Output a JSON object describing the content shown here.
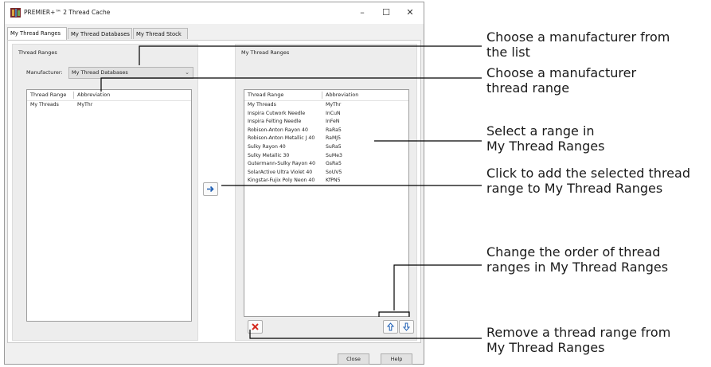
{
  "window": {
    "title": "PREMIER+™ 2 Thread Cache",
    "minimize": "–",
    "maximize": "☐",
    "close": "✕"
  },
  "tabs": [
    {
      "label": "My Thread Ranges",
      "active": true
    },
    {
      "label": "My Thread Databases",
      "active": false
    },
    {
      "label": "My Thread Stock",
      "active": false
    }
  ],
  "left_panel": {
    "group_label": "Thread Ranges",
    "manufacturer_label": "Manufacturer:",
    "manufacturer_value": "My Thread Databases",
    "columns": [
      "Thread Range",
      "Abbreviation"
    ],
    "rows": [
      [
        "My Threads",
        "MyThr"
      ]
    ]
  },
  "right_panel": {
    "group_label": "My Thread Ranges",
    "columns": [
      "Thread Range",
      "Abbreviation"
    ],
    "rows": [
      [
        "My Threads",
        "MyThr"
      ],
      [
        "Inspira Cutwork Needle",
        "InCuN"
      ],
      [
        "Inspira Felting Needle",
        "InFeN"
      ],
      [
        "Robison-Anton Rayon 40",
        "RaRa5"
      ],
      [
        "Robison-Anton Metallic J 40",
        "RaMJ5"
      ],
      [
        "Sulky Rayon 40",
        "SuRa5"
      ],
      [
        "Sulky Metallic 30",
        "SuMe3"
      ],
      [
        "Gutermann-Sulky Rayon 40",
        "GsRa5"
      ],
      [
        "SolarActive Ultra Violet 40",
        "SoUV5"
      ],
      [
        "Kingstar-Fujix Poly Neon 40",
        "KfPN5"
      ]
    ]
  },
  "buttons": {
    "close": "Close",
    "help": "Help"
  },
  "callouts": {
    "manufacturer": [
      "Choose a manufacturer from",
      "the list"
    ],
    "thread_range": [
      "Choose a manufacturer",
      "thread range"
    ],
    "select_range": [
      "Select a range in",
      "My Thread Ranges"
    ],
    "add": [
      "Click to add the selected thread",
      "range to My Thread Ranges"
    ],
    "order": [
      "Change the order of thread",
      "ranges in My Thread Ranges"
    ],
    "remove": [
      "Remove a thread range from",
      "My Thread Ranges"
    ]
  },
  "colors": {
    "add_arrow": "#1f5fb4",
    "remove_x": "#d42a1e",
    "move_arrows": "#1f5fb4"
  },
  "icons": [
    "app-icon",
    "minimize-icon",
    "maximize-icon",
    "close-icon",
    "chevron-down-icon",
    "add-arrow-icon",
    "remove-icon",
    "move-up-icon",
    "move-down-icon"
  ]
}
